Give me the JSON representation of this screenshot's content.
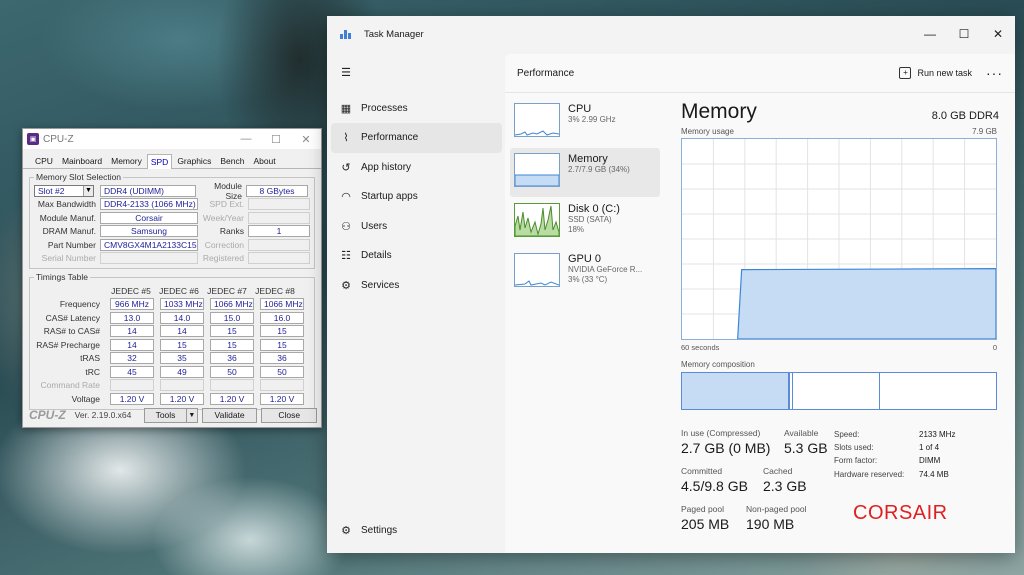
{
  "cpuz": {
    "title": "CPU-Z",
    "tabs": [
      "CPU",
      "Mainboard",
      "Memory",
      "SPD",
      "Graphics",
      "Bench",
      "About"
    ],
    "active_tab": "SPD",
    "slot_section": "Memory Slot Selection",
    "slot_value": "Slot #2",
    "module_type": "DDR4 (UDIMM)",
    "module_size_label": "Module Size",
    "module_size": "8 GBytes",
    "max_bandwidth_label": "Max Bandwidth",
    "max_bandwidth": "DDR4-2133 (1066 MHz)",
    "spd_ext_label": "SPD Ext.",
    "module_manuf_label": "Module Manuf.",
    "module_manuf": "Corsair",
    "week_year_label": "Week/Year",
    "dram_manuf_label": "DRAM Manuf.",
    "dram_manuf": "Samsung",
    "ranks_label": "Ranks",
    "ranks": "1",
    "part_number_label": "Part Number",
    "part_number": "CMV8GX4M1A2133C15",
    "correction_label": "Correction",
    "serial_label": "Serial Number",
    "registered_label": "Registered",
    "timings_section": "Timings Table",
    "timing_headers": [
      "JEDEC #5",
      "JEDEC #6",
      "JEDEC #7",
      "JEDEC #8"
    ],
    "timing_rows": [
      {
        "label": "Frequency",
        "values": [
          "966 MHz",
          "1033 MHz",
          "1066 MHz",
          "1066 MHz"
        ]
      },
      {
        "label": "CAS# Latency",
        "values": [
          "13.0",
          "14.0",
          "15.0",
          "16.0"
        ]
      },
      {
        "label": "RAS# to CAS#",
        "values": [
          "14",
          "14",
          "15",
          "15"
        ]
      },
      {
        "label": "RAS# Precharge",
        "values": [
          "14",
          "15",
          "15",
          "15"
        ]
      },
      {
        "label": "tRAS",
        "values": [
          "32",
          "35",
          "36",
          "36"
        ]
      },
      {
        "label": "tRC",
        "values": [
          "45",
          "49",
          "50",
          "50"
        ]
      },
      {
        "label": "Command Rate",
        "values": [
          "",
          "",
          "",
          ""
        ]
      },
      {
        "label": "Voltage",
        "values": [
          "1.20 V",
          "1.20 V",
          "1.20 V",
          "1.20 V"
        ]
      }
    ],
    "brand": "CPU-Z",
    "version": "Ver. 2.19.0.x64",
    "tools_label": "Tools",
    "validate_label": "Validate",
    "close_label": "Close"
  },
  "taskmanager": {
    "title": "Task Manager",
    "nav": [
      {
        "label": "Processes",
        "icon": "grid-icon"
      },
      {
        "label": "Performance",
        "icon": "pulse-icon"
      },
      {
        "label": "App history",
        "icon": "history-icon"
      },
      {
        "label": "Startup apps",
        "icon": "speedometer-icon"
      },
      {
        "label": "Users",
        "icon": "users-icon"
      },
      {
        "label": "Details",
        "icon": "list-icon"
      },
      {
        "label": "Services",
        "icon": "puzzle-icon"
      }
    ],
    "settings_label": "Settings",
    "header": "Performance",
    "run_task_label": "Run new task",
    "resources": [
      {
        "name": "CPU",
        "sub1": "3% 2.99 GHz",
        "sub2": ""
      },
      {
        "name": "Memory",
        "sub1": "2.7/7.9 GB (34%)",
        "sub2": ""
      },
      {
        "name": "Disk 0 (C:)",
        "sub1": "SSD (SATA)",
        "sub2": "18%"
      },
      {
        "name": "GPU 0",
        "sub1": "NVIDIA GeForce R...",
        "sub2": "3% (33 °C)"
      }
    ],
    "memory": {
      "title": "Memory",
      "spec": "8.0 GB DDR4",
      "usage_label": "Memory usage",
      "max_label": "7.9 GB",
      "time_left": "60 seconds",
      "time_right": "0",
      "composition_label": "Memory composition",
      "in_use_label": "In use (Compressed)",
      "in_use": "2.7 GB (0 MB)",
      "available_label": "Available",
      "available": "5.3 GB",
      "committed_label": "Committed",
      "committed": "4.5/9.8 GB",
      "cached_label": "Cached",
      "cached": "2.3 GB",
      "paged_label": "Paged pool",
      "paged": "205 MB",
      "nonpaged_label": "Non-paged pool",
      "nonpaged": "190 MB",
      "speed_label": "Speed:",
      "speed": "2133 MHz",
      "slots_label": "Slots used:",
      "slots": "1 of 4",
      "form_label": "Form factor:",
      "form": "DIMM",
      "reserved_label": "Hardware reserved:",
      "reserved": "74.4 MB",
      "usage_fraction": 0.34
    },
    "overlay_text": "CORSAIR"
  }
}
